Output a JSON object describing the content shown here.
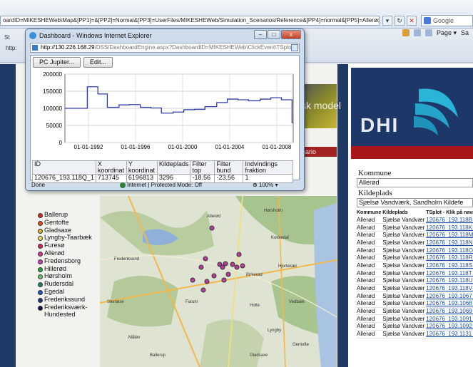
{
  "browser": {
    "address_text": "oardID=MIKESHEWeb\\Map&[PP1]=&[PP2]=Normal&[PP3]=UserFiles/MIKESHEWeb/Simulation_Scenarios/Reference&[PP4]=normal&[PP5]=Allerød&[PP6]=Allerød",
    "search_label": "Google",
    "tab_fragment": "http:",
    "cmd_page_label": "Page ▾",
    "cmd_s_label": "Sa",
    "toolbar_fragment_1": "St",
    "toolbar_fragment_2": "http:"
  },
  "popup": {
    "title": "Dashboard - Windows Internet Explorer",
    "url_host": "http://130.226.168.29",
    "url_path": "/DSS/DashboardEngine.aspx?DashboardID=MIKESHEWeb\\ClickEvent\\TSplot&[PP1]=12067",
    "buttons": [
      "PC Jupiter...",
      "Edit..."
    ],
    "status_done": "Done",
    "status_zone": "Internet | Protected Mode: Off",
    "status_zoom": "100%",
    "controls": {
      "minimize": "–",
      "maximize": "□",
      "close": "x"
    }
  },
  "info_table": {
    "headers": [
      "ID",
      "X koordinat",
      "Y koordinat",
      "Kildeplads",
      "Filter top",
      "Filter bund",
      "Indvindings fraktion"
    ],
    "values": [
      "120676_193.118Q_1",
      "713745",
      "6196813",
      "3296",
      "-18.56",
      "-23.56",
      "1"
    ]
  },
  "chart_data": {
    "type": "line",
    "title": "",
    "xlabel": "",
    "ylabel": "",
    "ylim": [
      0,
      200000
    ],
    "yticks": [
      "0",
      "50000",
      "100000",
      "150000",
      "200000"
    ],
    "xticks": [
      "01-01-1992",
      "01-01-1996",
      "01-01-2000",
      "01-01-2004",
      "01-01-2008"
    ],
    "grid": true,
    "series": [
      {
        "color": "#2f3ea8",
        "x": [
          1990.0,
          1991.0,
          1991.9,
          1992.8,
          1993.6,
          1994.6,
          1995.5,
          1996.4,
          1997.3,
          1998.2,
          1999.2,
          2000.1,
          2001.0,
          2001.9,
          2002.9,
          2003.8,
          2004.7,
          2005.6,
          2006.6,
          2007.5,
          2008.4,
          2009.3
        ],
        "y": [
          100000,
          100000,
          163000,
          142000,
          103000,
          110000,
          111000,
          103000,
          101000,
          86000,
          89000,
          96000,
          97000,
          105000,
          117000,
          127000,
          125000,
          122000,
          127000,
          131000,
          125000,
          58000
        ]
      }
    ]
  },
  "legend": [
    {
      "label": "Ballerup",
      "color": "#cc3020"
    },
    {
      "label": "Gentofte",
      "color": "#e05020"
    },
    {
      "label": "Gladsaxe",
      "color": "#d8b030"
    },
    {
      "label": "Lyngby-Taarbæk",
      "color": "#e8e060"
    },
    {
      "label": "Furesø",
      "color": "#c82a50"
    },
    {
      "label": "Allerød",
      "color": "#d8389a"
    },
    {
      "label": "Fredensborg",
      "color": "#c040b8"
    },
    {
      "label": "Hillerød",
      "color": "#30a040"
    },
    {
      "label": "Hørsholm",
      "color": "#70c070"
    },
    {
      "label": "Rudersdal",
      "color": "#208060"
    },
    {
      "label": "Egedal",
      "color": "#2050c0"
    },
    {
      "label": "Frederikssund",
      "color": "#203080"
    },
    {
      "label": "Frederiksværk-Hundested",
      "color": "#101040"
    }
  ],
  "banner": {
    "text": "sk model",
    "red_text": "nario"
  },
  "brand": {
    "text": "DHI"
  },
  "right_panel": {
    "kommune_label": "Kommune",
    "kommune_value": "Allerød",
    "kilde_label": "Kildeplads",
    "kilde_value": "Sjælsø Vandværk, Sandholm Kildefe",
    "table_headers": [
      "Kommune",
      "Kildeplads",
      "TSplot - Klik på navn"
    ],
    "rows": [
      [
        "Allerød",
        "Sjælsø Vandvær",
        "120676_193.118B_"
      ],
      [
        "Allerød",
        "Sjælsø Vandvær",
        "120676_193.118K_"
      ],
      [
        "Allerød",
        "Sjælsø Vandvær",
        "120676_193.118M_"
      ],
      [
        "Allerød",
        "Sjælsø Vandvær",
        "120676_193.118N_"
      ],
      [
        "Allerød",
        "Sjælsø Vandvær",
        "120676_193.118O_"
      ],
      [
        "Allerød",
        "Sjælsø Vandvær",
        "120676_193.118R_"
      ],
      [
        "Allerød",
        "Sjælsø Vandvær",
        "120676_193.118S_"
      ],
      [
        "Allerød",
        "Sjælsø Vandvær",
        "120676_193.118T_"
      ],
      [
        "Allerød",
        "Sjælsø Vandvær",
        "120676_193.118U_"
      ],
      [
        "Allerød",
        "Sjælsø Vandvær",
        "120676_193.118V_"
      ],
      [
        "Allerød",
        "Sjælsø Vandvær",
        "120676_193.1067_"
      ],
      [
        "Allerød",
        "Sjælsø Vandvær",
        "120676_193.1068_"
      ],
      [
        "Allerød",
        "Sjælsø Vandvær",
        "120676_193.1069_"
      ],
      [
        "Allerød",
        "Sjælsø Vandvær",
        "120676_193.1091_"
      ],
      [
        "Allerød",
        "Sjælsø Vandvær",
        "120676_193.1092_"
      ],
      [
        "Allerød",
        "Sjælsø Vandvær",
        "120676_193.1131_"
      ]
    ]
  },
  "map_labels": [
    "Hørsholm",
    "Allerød",
    "Birkerød",
    "Farum",
    "Kokkedal",
    "Vedbæk",
    "Holte",
    "Gladsaxe",
    "Gentofte",
    "Ballerup",
    "Måløv",
    "Stenløse",
    "Frederiksund",
    "Lyngby",
    "Hjortekær"
  ]
}
